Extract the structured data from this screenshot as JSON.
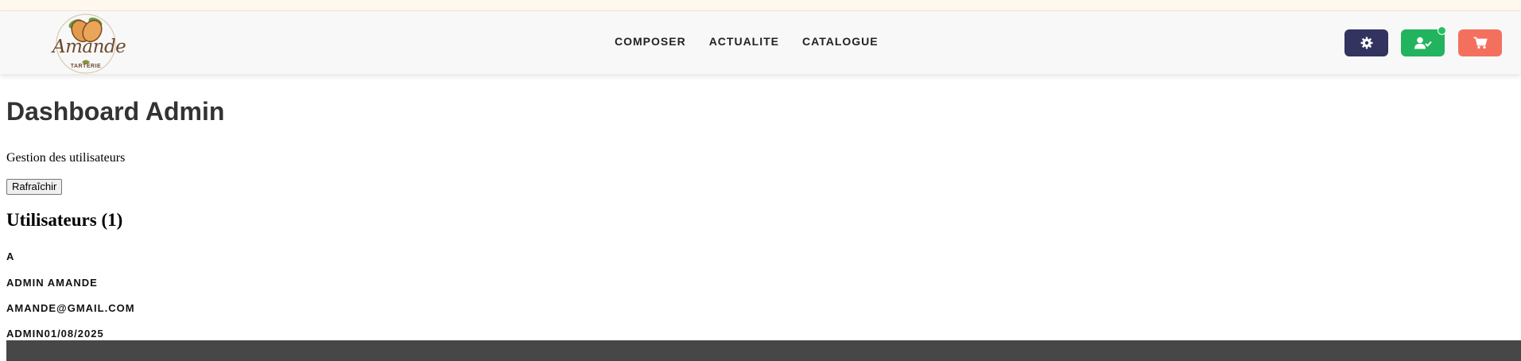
{
  "brand": {
    "name": "Amande",
    "tagline": "TARTERIE"
  },
  "nav": {
    "links": [
      {
        "label": "COMPOSER"
      },
      {
        "label": "ACTUALITE"
      },
      {
        "label": "CATALOGUE"
      }
    ],
    "buttons": {
      "settings_icon": "gear-icon",
      "account_icon": "user-check-icon",
      "cart_icon": "cart-icon",
      "account_online": true
    }
  },
  "page": {
    "title": "Dashboard Admin",
    "subtitle": "Gestion des utilisateurs",
    "refresh_label": "Rafraîchir",
    "users_heading": "Utilisateurs (1)"
  },
  "users": [
    {
      "initial": "A",
      "name": "ADMIN AMANDE",
      "email": "AMANDE@GMAIL.COM",
      "role_date": "ADMIN01/08/2025"
    }
  ],
  "colors": {
    "settings": "#33335f",
    "account": "#22b35e",
    "cart": "#f4705e",
    "footer": "#474747",
    "topstrip": "#fff8ee"
  }
}
